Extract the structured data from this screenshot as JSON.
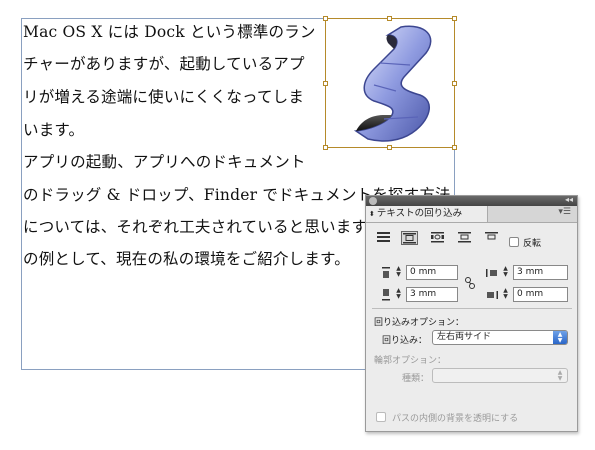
{
  "document": {
    "lines": [
      "Mac OS X には Dock という標準のラン",
      "チャーがありますが、起動しているアプ",
      "リが増える途端に使いにくくなってしま",
      "います。",
      "アプリの起動、アプリへのドキュメント",
      "のドラッグ & ドロップ、Finder でドキュメントを探す方法",
      "については、それぞれ工夫されていると思います。",
      "の例として、現在の私の環境をご紹介します。"
    ]
  },
  "panel": {
    "tab_label": "テキストの回り込み",
    "invert_label": "反転",
    "top_offset": "0 mm",
    "left_offset": "3 mm",
    "bottom_offset": "3 mm",
    "right_offset": "0 mm",
    "wrap_options_heading": "回り込みオプション：",
    "wrap_to_label": "回り込み：",
    "wrap_to_value": "左右両サイド",
    "contour_heading": "輪郭オプション：",
    "type_label": "種類：",
    "type_value": "",
    "transparent_label": "パスの内側の背景を透明にする"
  },
  "colors": {
    "text_frame_border": "#8aa0c0",
    "image_frame_border": "#b58a2a",
    "select_accent": "#2a66c8"
  }
}
